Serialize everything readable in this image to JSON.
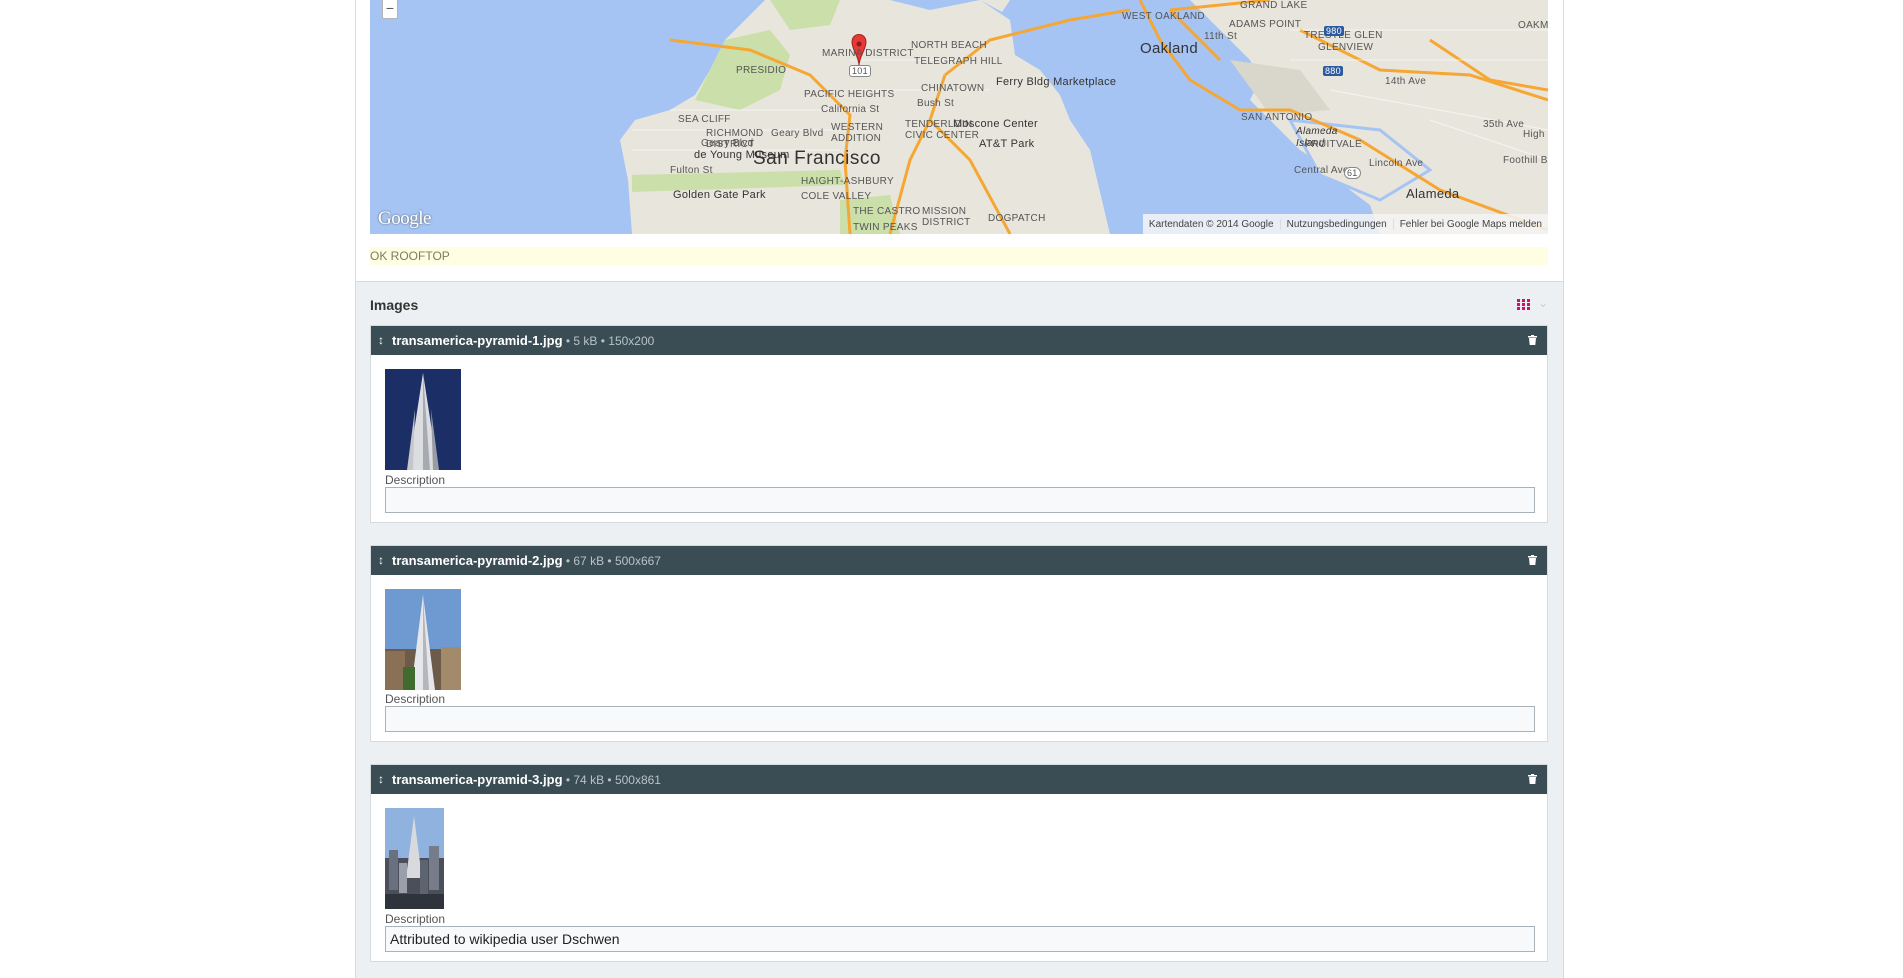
{
  "map": {
    "zoom_out_label": "−",
    "google_logo": "Google",
    "attribution": {
      "data": "Kartendaten © 2014 Google",
      "terms": "Nutzungsbedingungen",
      "report": "Fehler bei Google Maps melden"
    },
    "labels": {
      "san_francisco": "San Francisco",
      "oakland": "Oakland",
      "alameda": "Alameda",
      "alameda_island": "Alameda\nIsland",
      "ferry": "Ferry Bldg Marketplace",
      "moscone": "Moscone Center",
      "att_park": "AT&T Park",
      "de_young": "de Young Museum",
      "golden_gate_park": "Golden Gate Park",
      "presidio": "PRESIDIO",
      "marina": "MARINA DISTRICT",
      "north_beach": "NORTH BEACH",
      "telegraph_hill": "TELEGRAPH HILL",
      "chinatown": "CHINATOWN",
      "pacific_heights": "PACIFIC HEIGHTS",
      "sea_cliff": "SEA CLIFF",
      "richmond": "RICHMOND\nDISTRICT",
      "western_addition": "WESTERN\nADDITION",
      "tenderloin": "TENDERLOIN\nCIVIC CENTER",
      "haight": "HAIGHT-ASHBURY",
      "cole_valley": "COLE VALLEY",
      "castro": "THE CASTRO",
      "mission": "MISSION\nDISTRICT",
      "dogpatch": "DOGPATCH",
      "twin_peaks": "TWIN PEAKS",
      "west_oakland": "WEST OAKLAND",
      "adams_point": "ADAMS POINT",
      "grand_lake": "GRAND LAKE",
      "trestle_glen": "TRESTLE GLEN",
      "glenview": "GLENVIEW",
      "oakmo": "OAKMO",
      "san_antonio": "SAN ANTONIO",
      "fruitvale": "FRUITVALE",
      "bush_st": "Bush St",
      "california_st": "California St",
      "geary_blvd": "Geary Blvd",
      "geary_blvd2": "Geary Blvd",
      "fulton_st": "Fulton St",
      "central_ave": "Central Ave",
      "lincoln_ave": "Lincoln Ave",
      "th14": "14th Ave",
      "th35": "35th Ave",
      "high": "High",
      "foothill": "Foothill B",
      "st11": "11th St",
      "hw101": "101",
      "hw980": "980",
      "hw880": "880",
      "hw61": "61"
    }
  },
  "status": "OK ROOFTOP",
  "images_section": {
    "title": "Images",
    "items": [
      {
        "filename": "transamerica-pyramid-1.jpg",
        "meta": " • 5 kB • 150x200",
        "description_label": "Description",
        "description_value": ""
      },
      {
        "filename": "transamerica-pyramid-2.jpg",
        "meta": " • 67 kB • 500x667",
        "description_label": "Description",
        "description_value": ""
      },
      {
        "filename": "transamerica-pyramid-3.jpg",
        "meta": " • 74 kB • 500x861",
        "description_label": "Description",
        "description_value": "Attributed to wikipedia user Dschwen"
      }
    ]
  },
  "icons": {
    "drag": "drag-handle-icon",
    "trash": "trash-icon",
    "grid": "grid-view-icon",
    "chevron": "chevron-down-icon",
    "marker": "map-marker-icon"
  },
  "colors": {
    "header_bar": "#3a4c54",
    "water": "#a5c4f4",
    "land": "#e8e5dc",
    "park": "#cadfaa",
    "highway": "#f6a633",
    "status_bg": "#fffde2",
    "accent_grid": "#d0106f",
    "marker": "#e53935"
  }
}
